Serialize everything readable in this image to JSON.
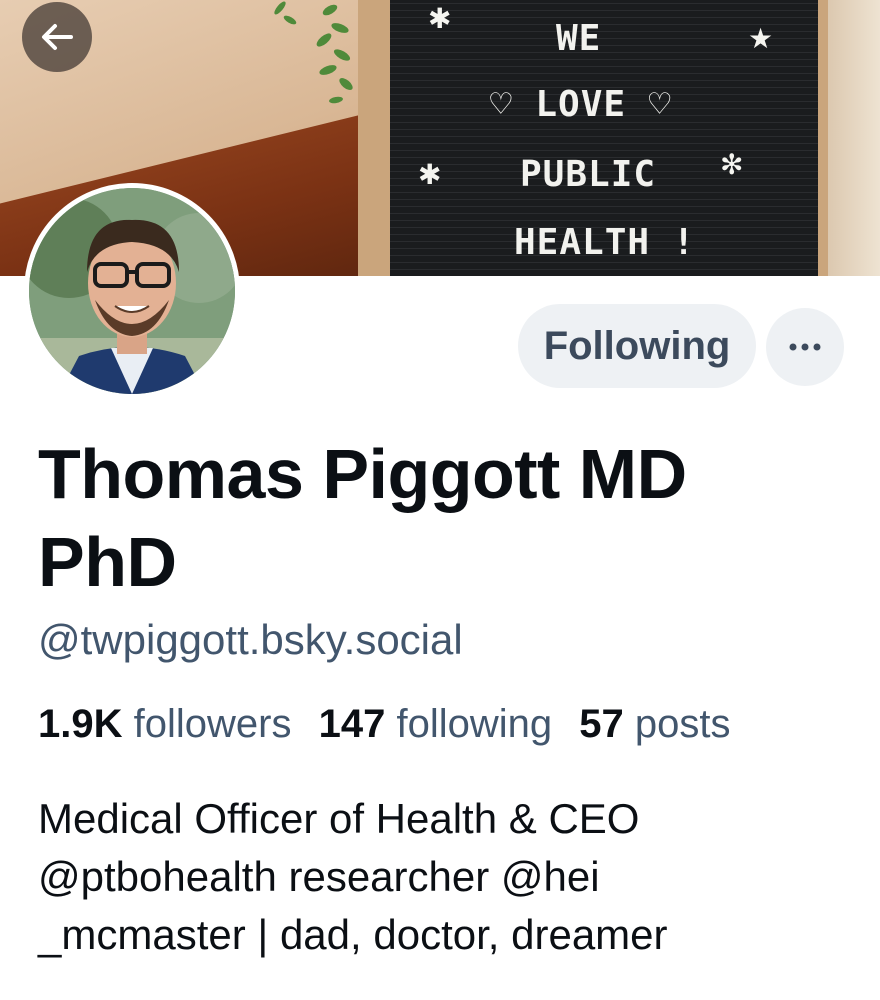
{
  "banner": {
    "letterboard_lines": [
      "WE",
      "♡ LOVE ♡",
      "PUBLIC",
      "HEALTH !"
    ]
  },
  "header": {
    "back_icon": "arrow-left-icon"
  },
  "profile": {
    "display_name": "Thomas Piggott MD PhD",
    "handle": "@twpiggott.bsky.social",
    "stats": {
      "followers_count": "1.9K",
      "followers_label": "followers",
      "following_count": "147",
      "following_label": "following",
      "posts_count": "57",
      "posts_label": "posts"
    },
    "bio_lines": [
      "Medical Officer of Health & CEO",
      "@ptbohealth researcher @hei",
      "_mcmaster | dad, doctor, dreamer"
    ]
  },
  "actions": {
    "follow_label": "Following",
    "more_icon": "ellipsis-icon"
  },
  "colors": {
    "accent_text": "#42566d",
    "button_bg": "#eef1f4",
    "primary_text": "#0b0f14"
  }
}
